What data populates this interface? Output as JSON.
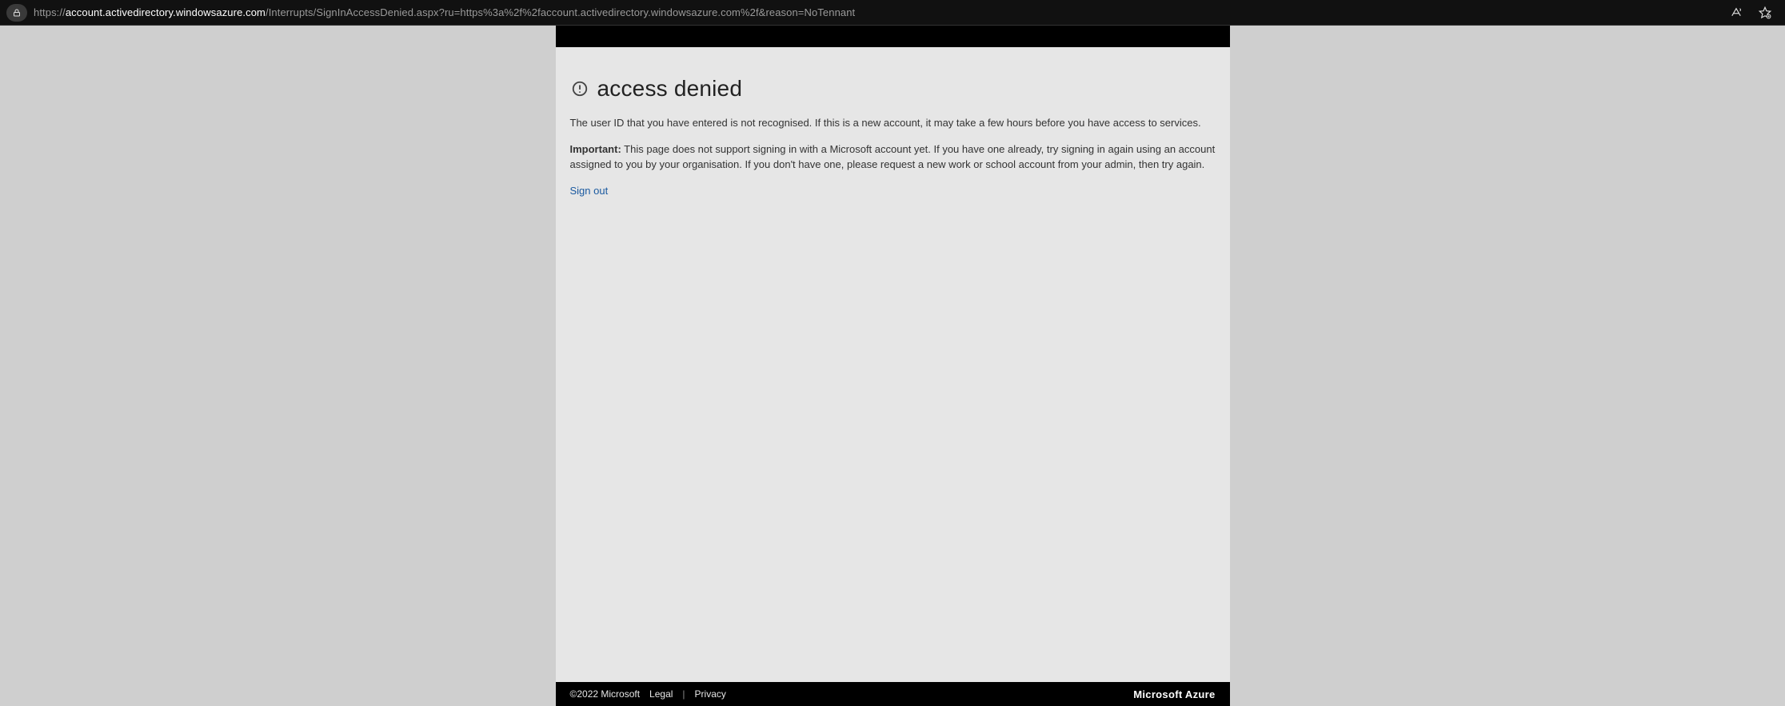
{
  "browser": {
    "url_prefix": "https://",
    "url_host": "account.activedirectory.windowsazure.com",
    "url_path": "/Interrupts/SignInAccessDenied.aspx?ru=https%3a%2f%2faccount.activedirectory.windowsazure.com%2f&reason=NoTennant"
  },
  "page": {
    "title": "access denied",
    "message1": "The user ID that you have entered is not recognised. If this is a new account, it may take a few hours before you have access to services.",
    "important_label": "Important:",
    "message2": "This page does not support signing in with a Microsoft account yet. If you have one already, try signing in again using an account assigned to you by your organisation. If you don't have one, please request a new work or school account from your admin, then try again.",
    "signout": "Sign out"
  },
  "footer": {
    "copyright": "©2022 Microsoft",
    "legal": "Legal",
    "privacy": "Privacy",
    "separator": "|",
    "brand": "Microsoft Azure"
  }
}
